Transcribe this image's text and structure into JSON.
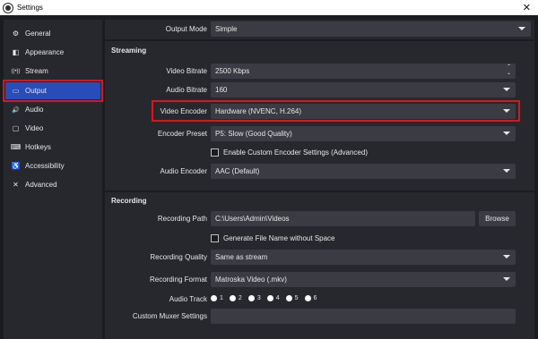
{
  "window": {
    "title": "Settings",
    "close_glyph": "✕"
  },
  "sidebar": {
    "items": [
      {
        "label": "General",
        "icon": "gear-icon",
        "glyph": "⚙"
      },
      {
        "label": "Appearance",
        "icon": "palette-icon",
        "glyph": "◧"
      },
      {
        "label": "Stream",
        "icon": "broadcast-icon",
        "glyph": "((•))"
      },
      {
        "label": "Output",
        "icon": "monitor-icon",
        "glyph": "▭"
      },
      {
        "label": "Audio",
        "icon": "speaker-icon",
        "glyph": "🔊"
      },
      {
        "label": "Video",
        "icon": "video-icon",
        "glyph": "▢"
      },
      {
        "label": "Hotkeys",
        "icon": "keyboard-icon",
        "glyph": "⌨"
      },
      {
        "label": "Accessibility",
        "icon": "accessibility-icon",
        "glyph": "♿"
      },
      {
        "label": "Advanced",
        "icon": "tools-icon",
        "glyph": "✕"
      }
    ],
    "active": "Output"
  },
  "output_mode": {
    "label": "Output Mode",
    "value": "Simple"
  },
  "streaming": {
    "title": "Streaming",
    "video_bitrate": {
      "label": "Video Bitrate",
      "value": "2500 Kbps"
    },
    "audio_bitrate": {
      "label": "Audio Bitrate",
      "value": "160"
    },
    "video_encoder": {
      "label": "Video Encoder",
      "value": "Hardware (NVENC, H.264)"
    },
    "encoder_preset": {
      "label": "Encoder Preset",
      "value": "P5: Slow (Good Quality)"
    },
    "custom_encoder": {
      "label": "Enable Custom Encoder Settings (Advanced)"
    },
    "audio_encoder": {
      "label": "Audio Encoder",
      "value": "AAC (Default)"
    }
  },
  "recording": {
    "title": "Recording",
    "path": {
      "label": "Recording Path",
      "value": "C:\\Users\\Admin\\Videos",
      "browse": "Browse"
    },
    "no_space": {
      "label": "Generate File Name without Space"
    },
    "quality": {
      "label": "Recording Quality",
      "value": "Same as stream"
    },
    "format": {
      "label": "Recording Format",
      "value": "Matroska Video (.mkv)"
    },
    "audio_track": {
      "label": "Audio Track",
      "tracks": [
        "1",
        "2",
        "3",
        "4",
        "5",
        "6"
      ]
    },
    "muxer": {
      "label": "Custom Muxer Settings",
      "value": ""
    }
  },
  "colors": {
    "accent": "#284cb8",
    "highlight": "#d8161c"
  }
}
